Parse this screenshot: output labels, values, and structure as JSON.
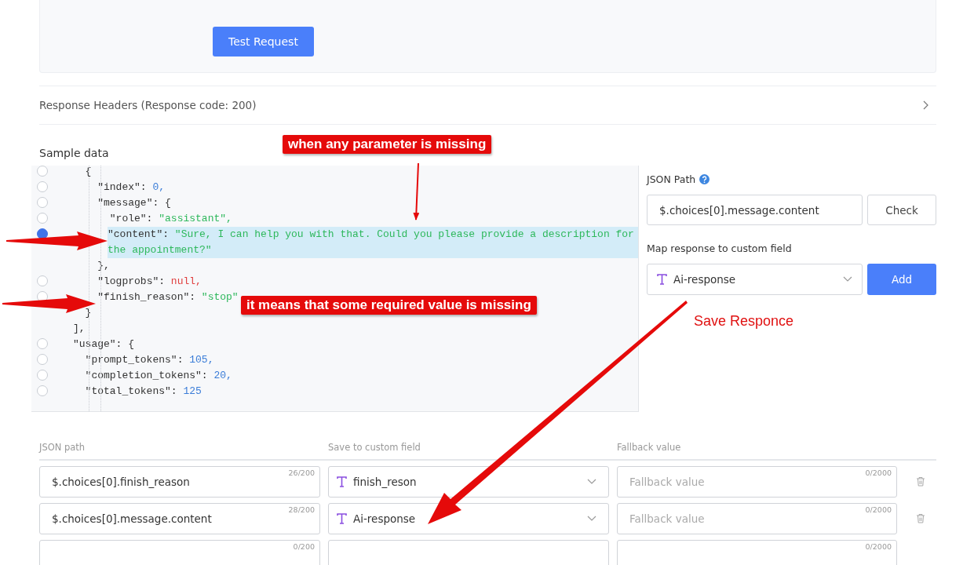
{
  "test_button": "Test Request",
  "response_headers": {
    "label": "Response Headers (Response code: 200)",
    "expanded": false
  },
  "sample_data": {
    "title": "Sample data",
    "lines": [
      {
        "kind": "radio",
        "selected": false,
        "tokens": [
          {
            "kind": "punct",
            "text": "  {"
          }
        ]
      },
      {
        "kind": "radio",
        "selected": false,
        "tokens": [
          {
            "kind": "punct",
            "text": "    \"index\": "
          },
          {
            "kind": "number",
            "text": "0,"
          }
        ]
      },
      {
        "kind": "radio",
        "selected": false,
        "tokens": [
          {
            "kind": "punct",
            "text": "    \"message\": {"
          }
        ]
      },
      {
        "kind": "radio",
        "selected": false,
        "tokens": [
          {
            "kind": "punct",
            "text": "      \"role\": "
          },
          {
            "kind": "string",
            "text": "\"assistant\","
          }
        ]
      },
      {
        "kind": "radio",
        "selected": true,
        "tokens": [
          {
            "kind": "punct",
            "text": "\"content\": "
          },
          {
            "kind": "string",
            "text": "\"Sure, I can help you with that. Could you please provide a description for the appointment?\""
          }
        ]
      },
      {
        "kind": "plain",
        "selected": false,
        "tokens": [
          {
            "kind": "punct",
            "text": "    },"
          }
        ]
      },
      {
        "kind": "radio",
        "selected": false,
        "tokens": [
          {
            "kind": "punct",
            "text": "    \"logprobs\": "
          },
          {
            "kind": "null",
            "text": "null,"
          }
        ]
      },
      {
        "kind": "radio",
        "selected": false,
        "tokens": [
          {
            "kind": "punct",
            "text": "    \"finish_reason\": "
          },
          {
            "kind": "string",
            "text": "\"stop\""
          }
        ]
      },
      {
        "kind": "plain",
        "selected": false,
        "tokens": [
          {
            "kind": "punct",
            "text": "  }"
          }
        ]
      },
      {
        "kind": "plain",
        "selected": false,
        "tokens": [
          {
            "kind": "punct",
            "text": "],"
          }
        ]
      },
      {
        "kind": "radio",
        "selected": false,
        "tokens": [
          {
            "kind": "punct",
            "text": "\"usage\": {"
          }
        ]
      },
      {
        "kind": "radio",
        "selected": false,
        "tokens": [
          {
            "kind": "punct",
            "text": "  \"prompt_tokens\": "
          },
          {
            "kind": "number",
            "text": "105,"
          }
        ]
      },
      {
        "kind": "radio",
        "selected": false,
        "tokens": [
          {
            "kind": "punct",
            "text": "  \"completion_tokens\": "
          },
          {
            "kind": "number",
            "text": "20,"
          }
        ]
      },
      {
        "kind": "radio",
        "selected": false,
        "tokens": [
          {
            "kind": "punct",
            "text": "  \"total_tokens\": "
          },
          {
            "kind": "number",
            "text": "125"
          }
        ]
      }
    ]
  },
  "json_path": {
    "label": "JSON Path",
    "value": "$.choices[0].message.content",
    "check_button": "Check"
  },
  "map": {
    "label": "Map response to custom field",
    "value": "Ai-response",
    "add_button": "Add"
  },
  "mappings": {
    "columns": [
      "JSON path",
      "Save to custom field",
      "Fallback value"
    ],
    "rows": [
      {
        "path": "$.choices[0].finish_reason",
        "path_count": "26/200",
        "field": "finish_reson",
        "fallback_placeholder": "Fallback value",
        "fallback_count": "0/2000"
      },
      {
        "path": "$.choices[0].message.content",
        "path_count": "28/200",
        "field": "Ai-response",
        "fallback_placeholder": "Fallback value",
        "fallback_count": "0/2000"
      },
      {
        "path_count": "0/200",
        "fallback_count": "0/2000"
      }
    ]
  },
  "annotations": [
    {
      "kind": "callout",
      "text": "when any parameter is missing"
    },
    {
      "kind": "callout",
      "text": "it means that some required value is missing"
    },
    {
      "kind": "note",
      "text": "Save Responce"
    }
  ]
}
